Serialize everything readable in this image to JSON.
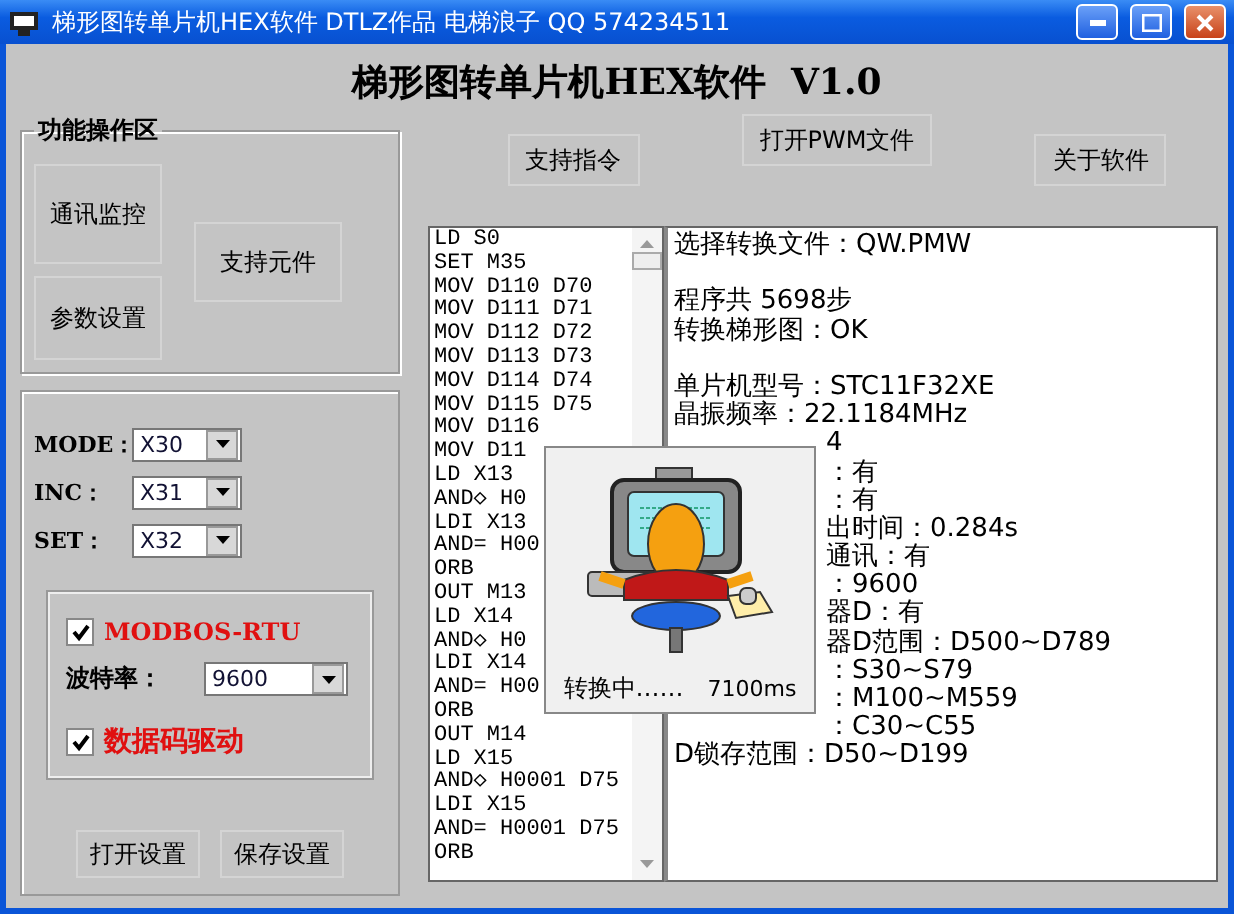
{
  "window": {
    "title": "梯形图转单片机HEX软件  DTLZ作品  电梯浪子 QQ 574234511"
  },
  "heading": "梯形图转单片机HEX软件  V1.0",
  "function_group": {
    "title": "功能操作区",
    "buttons": [
      "通讯监控",
      "参数设置",
      "支持元件"
    ]
  },
  "inputs": [
    {
      "label": "MODE：",
      "value": "X30"
    },
    {
      "label": "INC：",
      "value": "X31"
    },
    {
      "label": "SET：",
      "value": "X32"
    }
  ],
  "modbus_group": {
    "modbus": {
      "label": "MODBOS-RTU",
      "checked": true
    },
    "baud": {
      "label": "波特率：",
      "value": "9600"
    },
    "data_drive": {
      "label": "数据码驱动",
      "checked": true
    }
  },
  "settings_buttons": [
    "打开设置",
    "保存设置"
  ],
  "toolbar_buttons": [
    "支持指令",
    "打开PWM文件",
    "关于软件"
  ],
  "listing": [
    "LD S0",
    "SET M35",
    "MOV D110 D70",
    "MOV D111 D71",
    "MOV D112 D72",
    "MOV D113 D73",
    "MOV D114 D74",
    "MOV D115 D75",
    "MOV D116",
    "MOV D11",
    "LD X13",
    "AND◇ H0",
    "LDI X13",
    "AND= H00",
    "ORB",
    "OUT M13",
    "LD X14",
    "AND◇ H0",
    "LDI X14",
    "AND= H00",
    "ORB",
    "OUT M14",
    "LD X15",
    "AND◇ H0001 D75",
    "LDI X15",
    "AND= H0001 D75",
    "ORB"
  ],
  "output": [
    {
      "kind": "line",
      "text": "选择转换文件：QW.PMW"
    },
    {
      "kind": "blank"
    },
    {
      "kind": "line",
      "text": "程序共 5698步"
    },
    {
      "kind": "line",
      "text": "转换梯形图：OK"
    },
    {
      "kind": "blank"
    },
    {
      "kind": "line",
      "text": "单片机型号：STC11F32XE"
    },
    {
      "kind": "line",
      "text": "晶振频率：22.1184MHz"
    },
    {
      "kind": "partial",
      "text": "4"
    },
    {
      "kind": "partial",
      "text": "：有"
    },
    {
      "kind": "partial",
      "text": "：有"
    },
    {
      "kind": "partial",
      "text": "出时间：0.284s"
    },
    {
      "kind": "partial",
      "text": "通讯：有"
    },
    {
      "kind": "partial",
      "text": "：9600"
    },
    {
      "kind": "partial",
      "text": "器D：有"
    },
    {
      "kind": "partial",
      "text": "器D范围：D500~D789"
    },
    {
      "kind": "partial",
      "text": "：S30~S79"
    },
    {
      "kind": "partial",
      "text": "：M100~M559"
    },
    {
      "kind": "partial",
      "text": "：C30~C55"
    },
    {
      "kind": "line",
      "text": "D锁存范围：D50~D199"
    }
  ],
  "progress_dialog": {
    "status": "转换中……",
    "time": "7100ms"
  }
}
